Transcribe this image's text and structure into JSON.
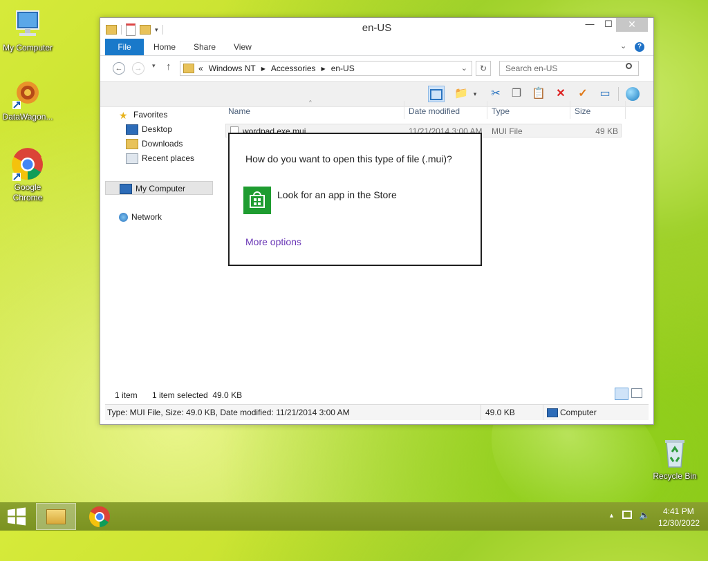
{
  "desktop": {
    "icons": [
      {
        "label": "My Computer"
      },
      {
        "label": "DataWagon..."
      },
      {
        "label": "Google Chrome"
      },
      {
        "label": "Recycle Bin"
      }
    ]
  },
  "window": {
    "title": "en-US",
    "tabs": [
      "File",
      "Home",
      "Share",
      "View"
    ],
    "address": {
      "prefix": "«",
      "crumbs": [
        "Windows NT",
        "Accessories",
        "en-US"
      ]
    },
    "search_placeholder": "Search en-US",
    "nav": {
      "favorites": "Favorites",
      "desktop": "Desktop",
      "downloads": "Downloads",
      "recent": "Recent places",
      "my_computer": "My Computer",
      "network": "Network"
    },
    "columns": [
      "Name",
      "Date modified",
      "Type",
      "Size"
    ],
    "files": [
      {
        "name": "wordpad.exe.mui",
        "date": "11/21/2014 3:00 AM",
        "type": "MUI File",
        "size": "49 KB"
      }
    ],
    "status": {
      "count": "1 item",
      "selected": "1 item selected  49.0 KB"
    },
    "details": {
      "info": "Type: MUI File, Size: 49.0 KB, Date modified: 11/21/2014 3:00 AM",
      "size": "49.0 KB",
      "location": "Computer"
    }
  },
  "popup": {
    "question": "How do you want to open this type of file (.mui)?",
    "store_option": "Look for an app in the Store",
    "more_options": "More options",
    "store_color": "#1e9c30",
    "link_color": "#6a37b6"
  },
  "taskbar": {
    "time": "4:41 PM",
    "date": "12/30/2022"
  }
}
